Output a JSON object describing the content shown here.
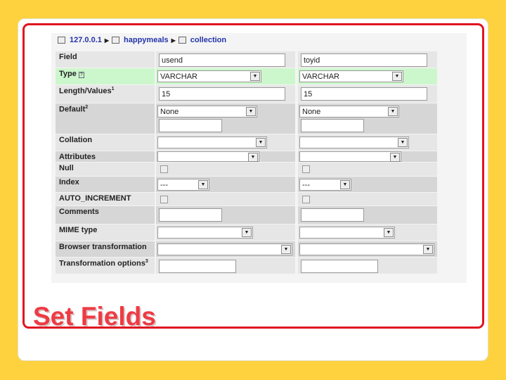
{
  "breadcrumb": {
    "server": "127.0.0.1",
    "database": "happymeals",
    "table": "collection"
  },
  "rows": [
    {
      "label": "Field",
      "kind": "text",
      "values": [
        "usend",
        "toyid"
      ]
    },
    {
      "label": "Type",
      "kind": "select",
      "help": "?",
      "values": [
        "VARCHAR",
        "VARCHAR"
      ]
    },
    {
      "label": "Length/Values",
      "sup": "1",
      "kind": "text",
      "values": [
        "15",
        "15"
      ]
    },
    {
      "label": "Default",
      "sup": "2",
      "kind": "select-text",
      "values": [
        "None",
        "None"
      ]
    },
    {
      "label": "Collation",
      "kind": "select",
      "values": [
        "",
        ""
      ]
    },
    {
      "label": "Attributes",
      "kind": "select",
      "values": [
        "",
        ""
      ]
    },
    {
      "label": "Null",
      "kind": "check",
      "values": [
        "",
        ""
      ]
    },
    {
      "label": "Index",
      "kind": "select",
      "values": [
        "---",
        "---"
      ]
    },
    {
      "label": "AUTO_INCREMENT",
      "kind": "check",
      "values": [
        "",
        ""
      ]
    },
    {
      "label": "Comments",
      "kind": "text",
      "values": [
        "",
        ""
      ]
    },
    {
      "label": "MIME type",
      "kind": "select",
      "values": [
        "",
        ""
      ]
    },
    {
      "label": "Browser transformation",
      "kind": "select",
      "values": [
        "",
        ""
      ]
    },
    {
      "label": "Transformation options",
      "sup": "3",
      "kind": "text",
      "values": [
        "",
        ""
      ]
    }
  ],
  "slide_title": "Set Fields"
}
